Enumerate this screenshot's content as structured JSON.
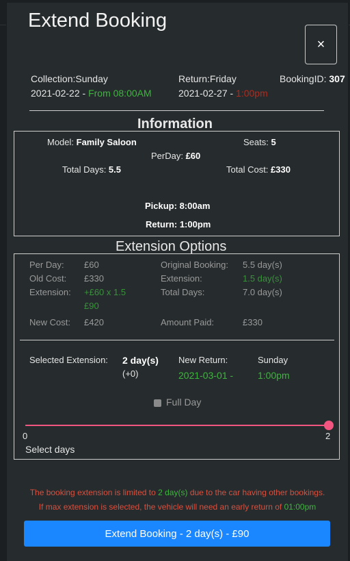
{
  "modal": {
    "title": "Extend Booking",
    "close_glyph": "×"
  },
  "summary": {
    "collection_label": "Collection:",
    "collection_day": "Sunday",
    "collection_date": "2021-02-22 - ",
    "collection_time": "From 08:00AM",
    "return_label": "Return:",
    "return_day": "Friday",
    "return_date": "2021-02-27 - ",
    "return_time": "1:00pm",
    "booking_id_label": "BookingID: ",
    "booking_id": "307"
  },
  "information": {
    "heading": "Information",
    "model_label": "Model: ",
    "model": "Family Saloon",
    "seats_label": "Seats: ",
    "seats": "5",
    "per_day_label": "PerDay: ",
    "per_day": "£60",
    "total_days_label": "Total Days: ",
    "total_days": "5.5",
    "total_cost_label": "Total Cost: ",
    "total_cost": "£330",
    "pickup": "Pickup: 8:00am",
    "return": "Return: 1:00pm"
  },
  "extension": {
    "heading": "Extension Options",
    "per_day_label": "Per Day:",
    "per_day": "£60",
    "old_cost_label": "Old Cost:",
    "old_cost": "£330",
    "extension_label": "Extension:",
    "extension_calc_1": "+£60 x 1.5",
    "extension_calc_2": "£90",
    "new_cost_label": "New Cost:",
    "new_cost": "£420",
    "original_booking_label": "Original Booking:",
    "original_booking": "5.5 day(s)",
    "extension_days_label": "Extension:",
    "extension_days": "1.5 day(s)",
    "total_days_label": "Total Days:",
    "total_days": "7.0 day(s)",
    "amount_paid_label": "Amount Paid:",
    "amount_paid": "£330",
    "selected_extension_label": "Selected Extension:",
    "selected_extension": "2 day(s)",
    "selected_extension_delta": "(+0)",
    "new_return_label": "New Return:",
    "new_return_date": "2021-03-01 -",
    "new_return_day": "Sunday",
    "new_return_time": "1:00pm",
    "full_day_label": "Full Day",
    "full_day_checked": false,
    "slider_min": "0",
    "slider_max": "2",
    "slider_value": 2,
    "slider_caption": "Select days"
  },
  "warning": {
    "line1_a": "The booking extension is limited to ",
    "line1_b": "2 day(s)",
    "line1_c": " due to the car having other bookings.",
    "line2_a": "If max extension is selected, the vehicle will need an early return of ",
    "line2_b": "01:00pm"
  },
  "actions": {
    "submit_label": "Extend Booking - 2 day(s) - £90"
  },
  "colors": {
    "accent_button": "#1a86ff",
    "slider": "#f2557f",
    "positive": "#3fb53f",
    "negative": "#b12a1e",
    "warning_text": "#d9503f"
  }
}
